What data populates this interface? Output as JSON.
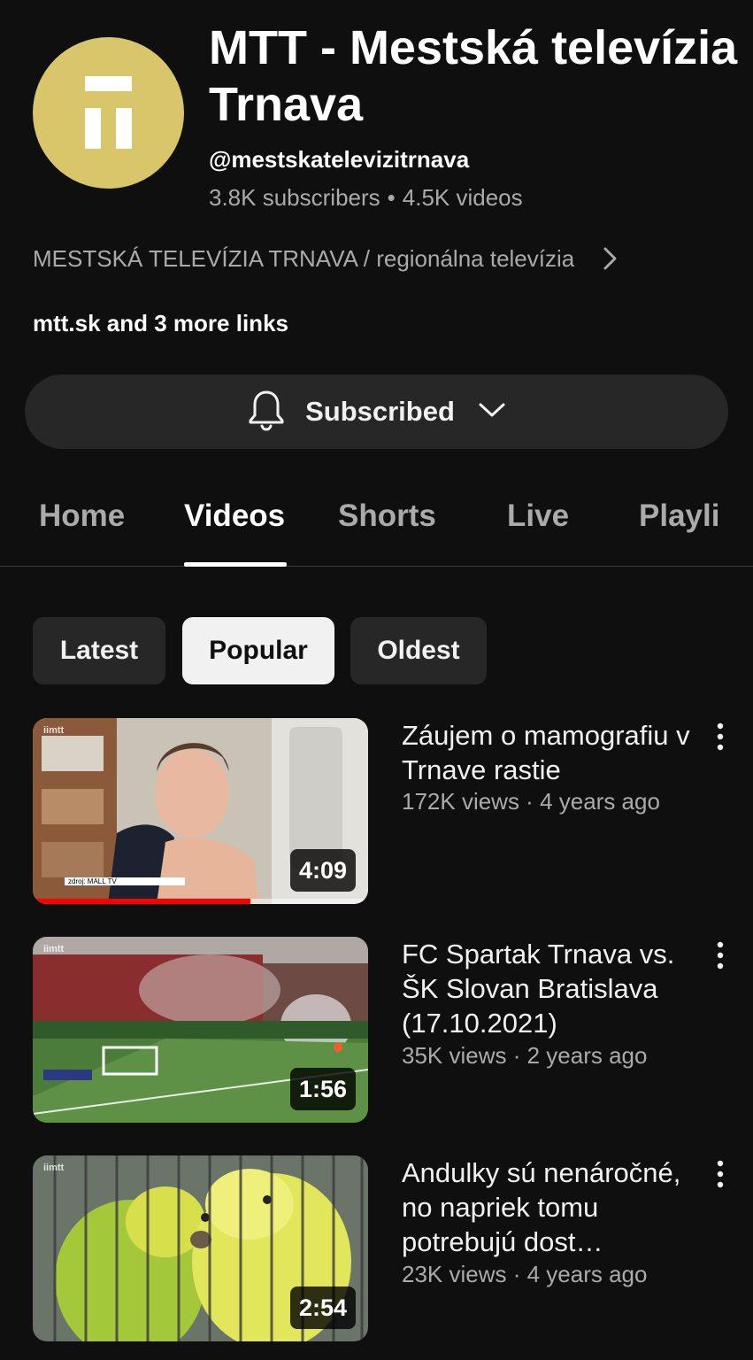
{
  "channel": {
    "name": "MTT - Mestská televízia Trnava",
    "handle": "@mestskatelevizitrnava",
    "subscribers": "3.8K subscribers",
    "videos": "4.5K videos",
    "separator": "•",
    "description": "MESTSKÁ TELEVÍZIA TRNAVA / regionálna televízia",
    "links": "mtt.sk and 3 more links",
    "avatar_color": "#d9c66a"
  },
  "subscribe": {
    "label": "Subscribed"
  },
  "tabs": [
    {
      "label": "Home"
    },
    {
      "label": "Videos"
    },
    {
      "label": "Shorts"
    },
    {
      "label": "Live"
    },
    {
      "label": "Playli"
    }
  ],
  "chips": [
    {
      "label": "Latest"
    },
    {
      "label": "Popular"
    },
    {
      "label": "Oldest"
    }
  ],
  "videos": [
    {
      "title": "Záujem o mamografiu v Trnave rastie",
      "meta": "172K views · 4 years ago",
      "duration": "4:09",
      "brand": "iimtt",
      "caption": "zdroj: MALL TV",
      "watched_fraction": 0.65
    },
    {
      "title": "FC Spartak Trnava vs. ŠK Slovan Bratislava (17.10.2021)",
      "meta": "35K views · 2 years ago",
      "duration": "1:56",
      "brand": "iimtt"
    },
    {
      "title": "Andulky sú nenáročné, no napriek tomu potrebujú dost…",
      "meta": "23K views · 4 years ago",
      "duration": "2:54",
      "brand": "iimtt"
    }
  ]
}
